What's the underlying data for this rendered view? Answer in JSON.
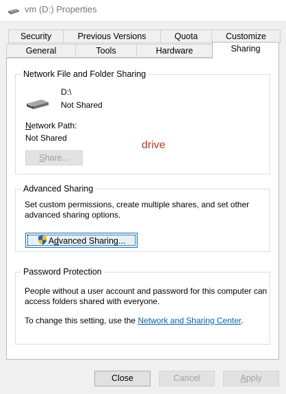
{
  "window": {
    "title": "vm (D:) Properties",
    "icon": "drive-icon"
  },
  "tabs": {
    "row1": [
      "Security",
      "Previous Versions",
      "Quota",
      "Customize"
    ],
    "row2": [
      "General",
      "Tools",
      "Hardware",
      "Sharing"
    ],
    "active": "Sharing"
  },
  "network_sharing": {
    "title": "Network File and Folder Sharing",
    "drive_name": "D:\\",
    "drive_status": "Not Shared",
    "path_label": "Network Path:",
    "path_label_key": "N",
    "path_label_rest": "etwork Path:",
    "path_value": "Not Shared",
    "share_button": "Share...",
    "share_key": "S",
    "share_rest": "hare..."
  },
  "annotation": "drive",
  "advanced_sharing": {
    "title": "Advanced Sharing",
    "description": "Set custom permissions, create multiple shares, and set other advanced sharing options.",
    "button": "Advanced Sharing...",
    "button_key": "d",
    "button_pre": "A",
    "button_post": "vanced Sharing..."
  },
  "password_protection": {
    "title": "Password Protection",
    "description": "People without a user account and password for this computer can access folders shared with everyone.",
    "change_prefix": "To change this setting, use the ",
    "link": "Network and Sharing Center",
    "change_suffix": "."
  },
  "buttons": {
    "close": "Close",
    "cancel": "Cancel",
    "apply": "Apply",
    "apply_key": "A",
    "apply_rest": "pply"
  },
  "colors": {
    "link": "#0063b1",
    "annotation": "#c0392b",
    "focus_border": "#0078d7"
  }
}
